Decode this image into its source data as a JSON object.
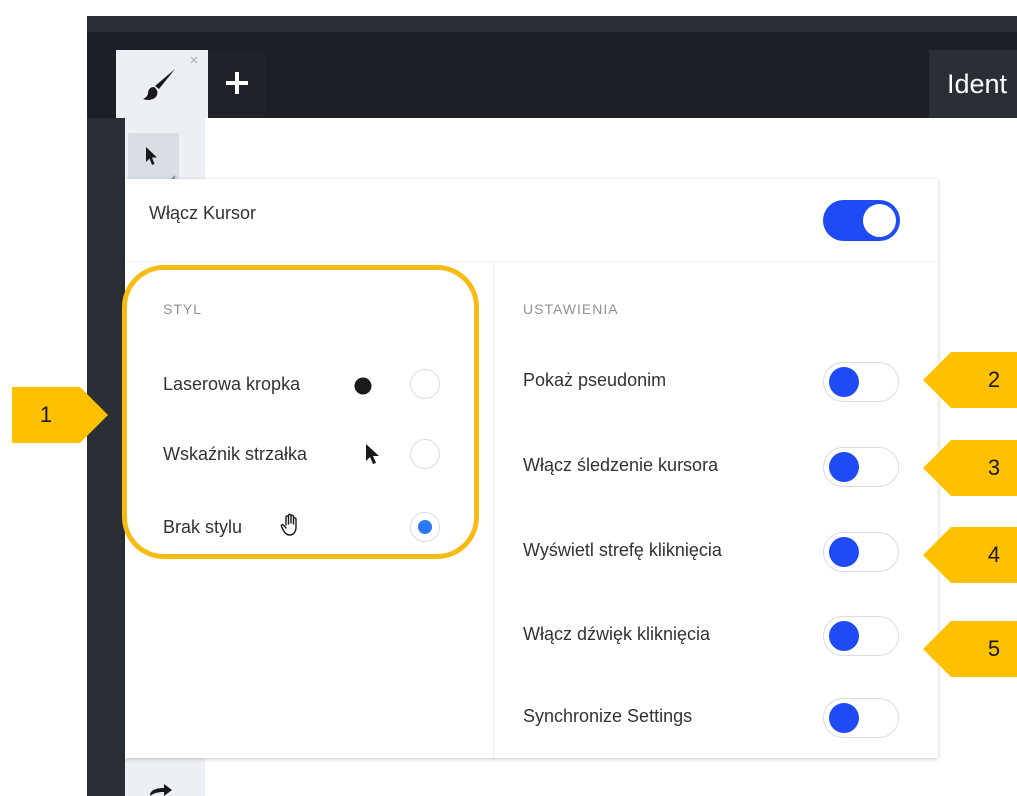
{
  "topbar": {
    "brush_tab_icon": "paintbrush-icon",
    "close_icon": "close-icon",
    "close_glyph": "×",
    "add_tab_icon": "plus-icon",
    "title": "Ident"
  },
  "toolbar": {
    "cursor_tool_icon": "cursor-arrow-icon"
  },
  "panel": {
    "header_label": "Włącz Kursor",
    "header_toggle_on": true,
    "style_section_title": "STYL",
    "settings_section_title": "USTAWIENIA",
    "style_options": [
      {
        "label": "Laserowa kropka",
        "icon": "laser-dot-icon",
        "selected": false
      },
      {
        "label": "Wskaźnik strzałka",
        "icon": "arrow-pointer-icon",
        "selected": false
      },
      {
        "label": "Brak stylu",
        "icon": "hand-pointer-icon",
        "selected": true
      }
    ],
    "settings": [
      {
        "label": "Pokaż pseudonim",
        "on": false
      },
      {
        "label": "Włącz śledzenie kursora",
        "on": false
      },
      {
        "label": "Wyświetl strefę kliknięcia",
        "on": false
      },
      {
        "label": "Włącz dźwięk kliknięcia",
        "on": false
      },
      {
        "label": "Synchronize Settings",
        "on": false
      }
    ]
  },
  "callouts": [
    "1",
    "2",
    "3",
    "4",
    "5"
  ],
  "colors": {
    "accent_blue": "#1f4bf5",
    "radio_blue": "#2879f3",
    "highlight": "#f6bb14",
    "callout": "#ffc000",
    "dark_bg": "#1c2026"
  }
}
